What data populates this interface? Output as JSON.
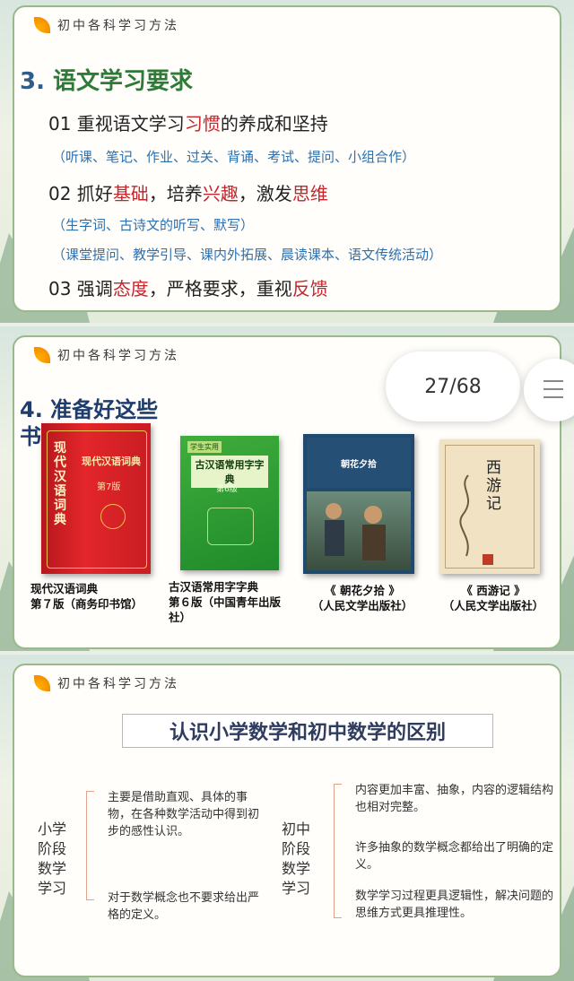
{
  "header": "初中各科学习方法",
  "slide1": {
    "title_num": "3.",
    "title": "语文学习要求",
    "p1": {
      "a": "01 重视语文学习",
      "b": "习惯",
      "c": "的养成和坚持"
    },
    "p1_sub": "（听课、笔记、作业、过关、背诵、考试、提问、小组合作）",
    "p2": {
      "a": "02 抓好",
      "b": "基础",
      "c": "，培养",
      "d": "兴趣",
      "e": "，激发",
      "f": "思维"
    },
    "p2_sub1": "（生字词、古诗文的听写、默写）",
    "p2_sub2": "（课堂提问、教学引导、课内外拓展、晨读课本、语文传统活动）",
    "p3": {
      "a": "03 强调",
      "b": "态度",
      "c": "，严格要求，重视",
      "d": "反馈"
    }
  },
  "slide2": {
    "title": "4. 准备好这些书：",
    "pager": "27/68",
    "books": [
      {
        "cover": "现代汉语词典",
        "edition": "第7版",
        "caption": "现代汉语词典\n第７版（商务印书馆）"
      },
      {
        "cover_top": "学生实用",
        "cover": "古汉语常用字字典",
        "edition": "第6版",
        "caption": "古汉语常用字字典\n第６版（中国青年出版社）"
      },
      {
        "cover": "朝花夕拾",
        "caption": "《 朝花夕拾 》\n（人民文学出版社）"
      },
      {
        "cover": "西游记",
        "caption": "《 西游记 》\n（人民文学出版社）"
      }
    ]
  },
  "slide3": {
    "title": "认识小学数学和初中数学的区别",
    "primary": {
      "label": "小学阶段数学学习",
      "items": [
        "主要是借助直观、具体的事物，在各种数学活动中得到初步的感性认识。",
        "对于数学概念也不要求给出严格的定义。"
      ]
    },
    "junior": {
      "label": "初中阶段数学学习",
      "items": [
        "内容更加丰富、抽象，内容的逻辑结构也相对完整。",
        "许多抽象的数学概念都给出了明确的定义。",
        "数学学习过程更具逻辑性，解决问题的思维方式更具推理性。"
      ]
    },
    "colors": {
      "accent": "#c4262e",
      "green": "#2e7a37",
      "blue": "#2d70ae"
    }
  }
}
